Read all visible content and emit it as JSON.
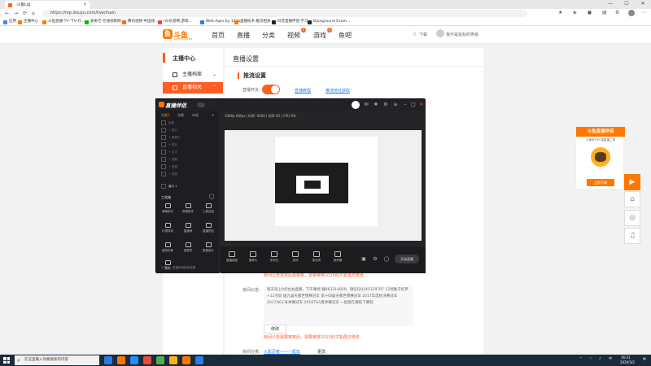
{
  "browser": {
    "tab_title": "斗鱼Lig",
    "window_controls": [
      "—",
      "☐",
      "✕"
    ],
    "address": "https://mp.douyu.com/live/main",
    "nav_icons": [
      "back-icon",
      "forward-icon",
      "reload-icon",
      "home-icon"
    ],
    "bookmarks": [
      {
        "label": "应用",
        "color": "#4285f4"
      },
      {
        "label": "主播中心",
        "color": "#ff7700"
      },
      {
        "label": "斗鱼直播-TV·\"TV·打...",
        "color": "#ff7700"
      },
      {
        "label": "爱奇艺-在线视频网...",
        "color": "#00be06"
      },
      {
        "label": "腾讯视频-中国领...",
        "color": "#ff6a00"
      },
      {
        "label": "hlil乐游网·游戏...",
        "color": "#e84a3c"
      },
      {
        "label": "Web Apps by 123a...",
        "color": "#2d7be5"
      },
      {
        "label": "直播技术·推流相关...",
        "color": "#ff7700"
      },
      {
        "label": "抖音直播伴侣·学习...",
        "color": "#222222"
      },
      {
        "label": "Background Exam...",
        "color": "#2b2b2b"
      }
    ]
  },
  "site": {
    "logo_text": "斗鱼",
    "logo_url": "DOUYU.COM",
    "nav": [
      "首页",
      "直播",
      "分类",
      "视频",
      "游戏",
      "鱼吧"
    ],
    "video_badge": "1",
    "game_badge": "2",
    "download_label": "下载",
    "user_label": "我不是鼠标的男孩"
  },
  "sidebar": {
    "heading": "主播中心",
    "items": [
      {
        "label": "主播档案",
        "active": false
      },
      {
        "label": "直播相关",
        "active": true
      }
    ]
  },
  "main": {
    "title": "直播设置",
    "section": "推流设置",
    "toggle_label": "直播开关:",
    "links": [
      "直播教程",
      "推流地址获取"
    ],
    "warning_1": "房间公告发布后需审核，需要审核1015秒才能再次修改",
    "announce_label": "房间公告:",
    "announce_text": "每天早上9点左右直播，下午睡觉 群863314929，微信QQ245129797  12场胜子好梦+12点前 国九届天都世锦赛冠军 第十四届天都世锦赛冠军 2017年度抗决赛冠军 2017QGC冬季赛冠军 2018TGA夏季赛冠军 一起跟在赛程下赛程",
    "edit_label": "修改",
    "warning_2": "房间公告需要审核后，需要审核1015秒才能再次修改",
    "category_label": "房间分类:",
    "category_value": "火影忍者——一起玩",
    "change_label": "更改"
  },
  "promo": {
    "title": "斗鱼直播伴侣",
    "desc": "斗鱼官方PC端直播工具",
    "download_label": "立即下载",
    "side_buttons": [
      "play-icon",
      "home-icon",
      "gamepad-icon",
      "headset-icon"
    ]
  },
  "app": {
    "title": "直播伴侣",
    "tabs": [
      "场景1",
      "场景",
      "布局"
    ],
    "scenes": [
      "全屏",
      "+ 窗口",
      "+ 摄像头",
      "+ 图片",
      "+ 文字",
      "+ 视频",
      "+ 音频",
      "+ 录屏"
    ],
    "scene_selected": "窗口 1",
    "tools_title": "工具箱",
    "tools": [
      "弹幕助手",
      "房管助手",
      "上麦连线",
      "礼物特效",
      "直播间",
      "直播预告",
      "虚拟形象",
      "录屏机",
      "数据统计",
      "美颜"
    ],
    "top_toolbar": "1080p 60fps  |  码率: 6000  |  帧率 60  |  CPU 9%",
    "bottom_tools": [
      "直播画面",
      "摄像头",
      "多机位",
      "游戏",
      "麦克风",
      "扬声器"
    ],
    "start_label": "开始直播",
    "tip": "小提示：直播前请检查设置"
  },
  "taskbar": {
    "search_placeholder": "在这里输入你要搜索的内容",
    "apps": [
      "#2d7be5",
      "#ff7700",
      "#1e90ff",
      "#e84a3c",
      "#4caf50",
      "#ffb020",
      "#ff7700",
      "#2b7de9"
    ],
    "time": "16:21",
    "date": "2020/3/2"
  }
}
